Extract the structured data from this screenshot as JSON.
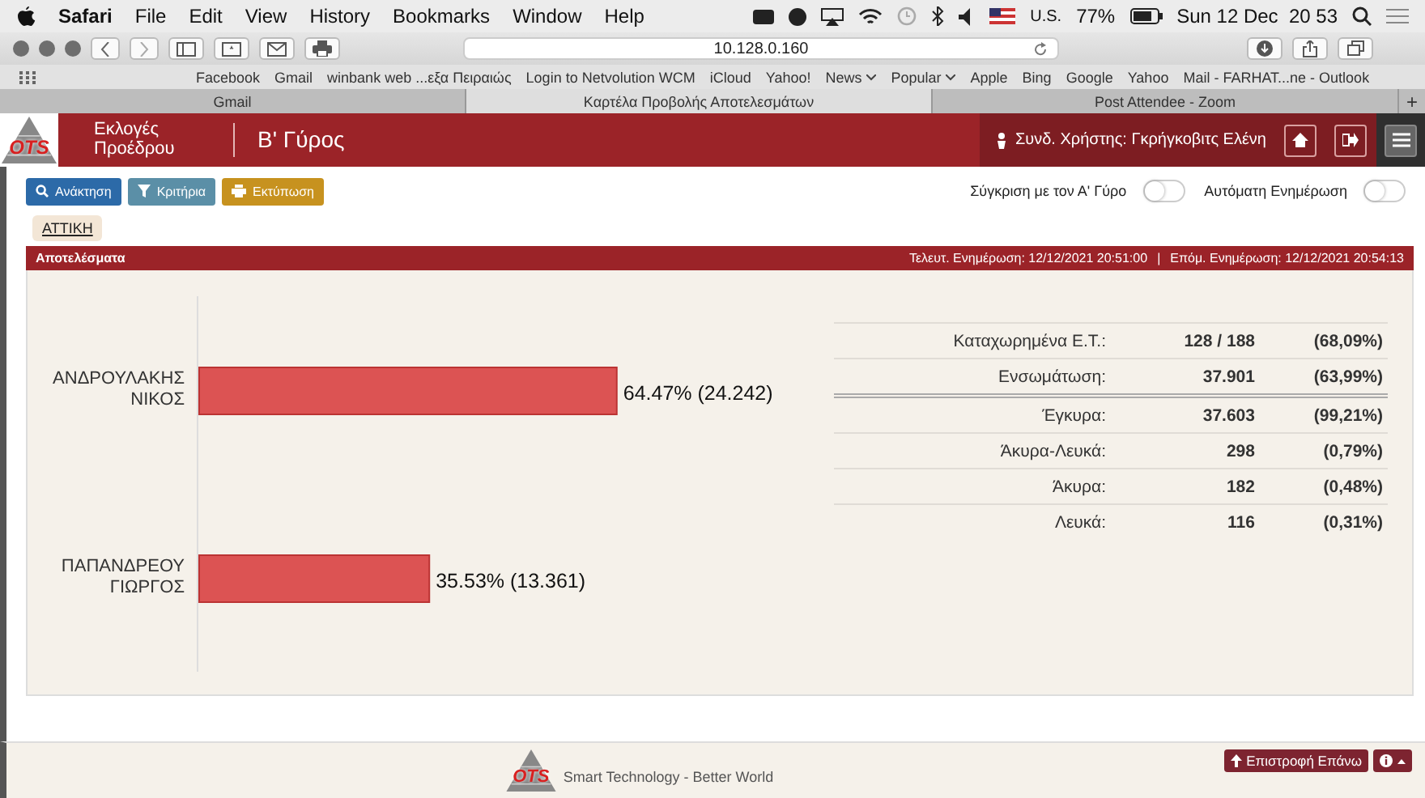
{
  "menubar": {
    "app": "Safari",
    "menus": [
      "File",
      "Edit",
      "View",
      "History",
      "Bookmarks",
      "Window",
      "Help"
    ],
    "input_source": "U.S.",
    "battery": "77%",
    "clock": "Sun 12 Dec  20 53"
  },
  "browser": {
    "url": "10.128.0.160",
    "bookmarks": [
      {
        "label": "Facebook",
        "kind": "link"
      },
      {
        "label": "Gmail",
        "kind": "link"
      },
      {
        "label": "winbank web ...εξα Πειραιώς",
        "kind": "link"
      },
      {
        "label": "Login to Netvolution WCM",
        "kind": "link"
      },
      {
        "label": "iCloud",
        "kind": "link"
      },
      {
        "label": "Yahoo!",
        "kind": "link"
      },
      {
        "label": "News",
        "kind": "folder"
      },
      {
        "label": "Popular",
        "kind": "folder"
      },
      {
        "label": "Apple",
        "kind": "link"
      },
      {
        "label": "Bing",
        "kind": "link"
      },
      {
        "label": "Google",
        "kind": "link"
      },
      {
        "label": "Yahoo",
        "kind": "link"
      },
      {
        "label": "Mail - FARHAT...ne - Outlook",
        "kind": "link"
      }
    ],
    "tabs": [
      {
        "label": "Gmail",
        "selected": false
      },
      {
        "label": "Καρτέλα Προβολής Αποτελεσμάτων",
        "selected": true
      },
      {
        "label": "Post Attendee - Zoom",
        "selected": false
      }
    ],
    "new_tab": "+"
  },
  "header": {
    "logo": "OTS",
    "title": "Εκλογές Προέδρου",
    "round": "Β' Γύρος",
    "user": "Συνδ. Χρήστης: Γκρήγκοβιτς Ελένη"
  },
  "toolbar": {
    "buttons": [
      {
        "label": "Ανάκτηση",
        "kind": "search"
      },
      {
        "label": "Κριτήρια",
        "kind": "filter"
      },
      {
        "label": "Εκτύπωση",
        "kind": "print"
      }
    ],
    "toggles": [
      {
        "label": "Σύγκριση με τον Α' Γύρο",
        "on": false
      },
      {
        "label": "Αυτόματη Ενημέρωση",
        "on": false
      }
    ],
    "region": "ΑΤΤΙΚΗ"
  },
  "results": {
    "title": "Αποτελέσματα",
    "last_update": "Τελευτ. Ενημέρωση: 12/12/2021 20:51:00",
    "divider": "|",
    "next_update": "Επόμ. Ενημέρωση: 12/12/2021 20:54:13",
    "chart_data": {
      "type": "bar",
      "orientation": "horizontal",
      "categories": [
        "ΑΝΔΡΟΥΛΑΚΗΣ ΝΙΚΟΣ",
        "ΠΑΠΑΝΔΡΕΟΥ ΓΙΩΡΓΟΣ"
      ],
      "values": [
        64.47,
        35.53
      ],
      "value_labels": [
        "64.47% (24.242)",
        "35.53% (13.361)"
      ]
    },
    "stats": [
      {
        "label": "Καταχωρημένα Ε.Τ.:",
        "value": "128 / 188",
        "percent": "(68,09%)",
        "separator_below": false
      },
      {
        "label": "Ενσωμάτωση:",
        "value": "37.901",
        "percent": "(63,99%)",
        "separator_below": true
      },
      {
        "label": "Έγκυρα:",
        "value": "37.603",
        "percent": "(99,21%)",
        "separator_below": false
      },
      {
        "label": "Άκυρα-Λευκά:",
        "value": "298",
        "percent": "(0,79%)",
        "separator_below": false
      },
      {
        "label": "Άκυρα:",
        "value": "182",
        "percent": "(0,48%)",
        "separator_below": false
      },
      {
        "label": "Λευκά:",
        "value": "116",
        "percent": "(0,31%)",
        "separator_below": false
      }
    ]
  },
  "footer": {
    "logo": "OTS",
    "tagline": "Smart Technology - Better World",
    "back_to_top": "Επιστροφή Επάνω"
  }
}
